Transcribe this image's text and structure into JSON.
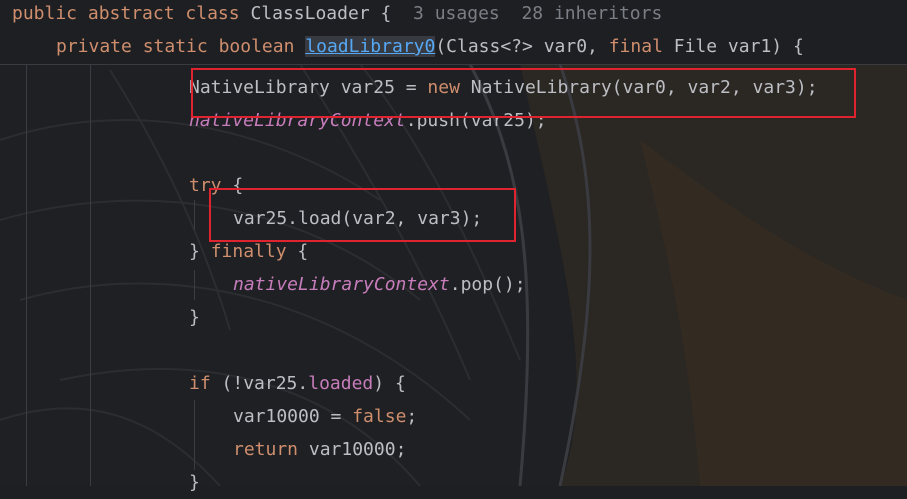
{
  "sticky": {
    "class_kw1": "public",
    "class_kw2": "abstract",
    "class_kw3": "class",
    "class_name": "ClassLoader",
    "class_brace": "{",
    "usages": "3 usages",
    "inheritors": "28 inheritors",
    "method_kw1": "private",
    "method_kw2": "static",
    "method_kw3": "boolean",
    "method_name": "loadLibrary0",
    "method_params_a": "(Class<?> var0, ",
    "method_final": "final",
    "method_params_b": " File var1) {"
  },
  "code": {
    "l1_a": "NativeLibrary var25 = ",
    "l1_new": "new",
    "l1_b": " NativeLibrary(var0, var2, var3);",
    "l2_field": "nativeLibraryContext",
    "l2_b": ".push(var25);",
    "l3_try": "try",
    "l3_b": " {",
    "l4": "var25.load(var2, var3);",
    "l5_a": "} ",
    "l5_finally": "finally",
    "l5_b": " {",
    "l6_field": "nativeLibraryContext",
    "l6_b": ".pop();",
    "l7": "}",
    "l8_if": "if",
    "l8_a": " (!var25.",
    "l8_field": "loaded",
    "l8_b": ") {",
    "l9_a": "var10000 = ",
    "l9_false": "false",
    "l9_b": ";",
    "l10_return": "return",
    "l10_b": " var10000;",
    "l11": "}"
  },
  "colors": {
    "keyword": "#cf8e6d",
    "method": "#56a8f5",
    "field": "#c77dbb",
    "hint": "#7a7e85",
    "highlight_box": "#e0242f"
  }
}
